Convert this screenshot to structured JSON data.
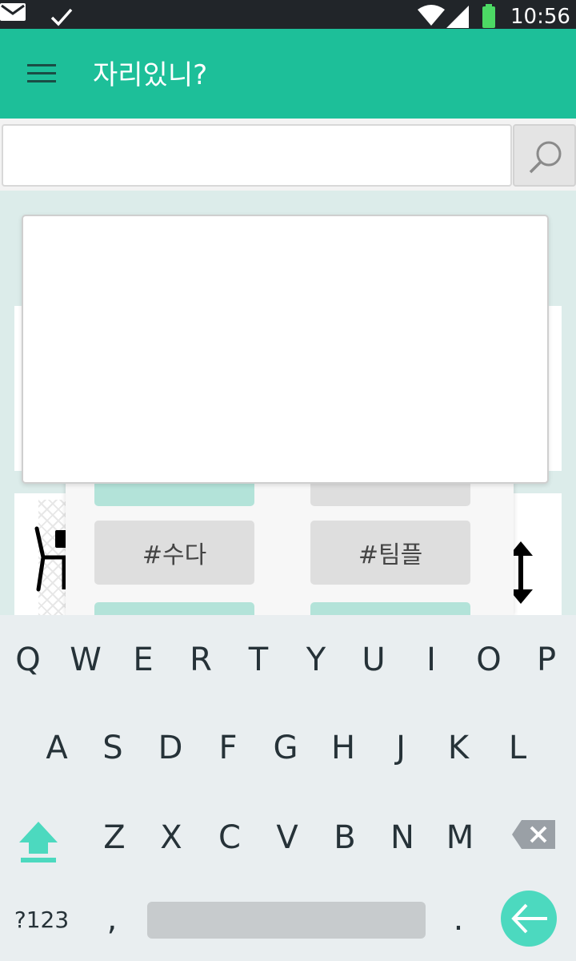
{
  "status_bar": {
    "time": "10:56",
    "icons": [
      "mail-icon",
      "check-icon",
      "wifi-icon",
      "cell-signal-icon",
      "battery-icon"
    ]
  },
  "app_bar": {
    "title": "자리있니?",
    "menu_icon": "hamburger-menu-icon"
  },
  "search": {
    "value": "",
    "button_icon": "search-icon"
  },
  "tags": {
    "row2_left": "#수다",
    "row2_right": "#팀플"
  },
  "keyboard": {
    "row1": [
      "Q",
      "W",
      "E",
      "R",
      "T",
      "Y",
      "U",
      "I",
      "O",
      "P"
    ],
    "row2": [
      "A",
      "S",
      "D",
      "F",
      "G",
      "H",
      "J",
      "K",
      "L"
    ],
    "row3": [
      "Z",
      "X",
      "C",
      "V",
      "B",
      "N",
      "M"
    ],
    "symbols": "?123",
    "comma": ",",
    "period": "."
  },
  "colors": {
    "accent": "#1dbf99",
    "enter": "#4cd9bf",
    "tag_teal": "#b3e3d9",
    "tag_gray": "#dedede"
  }
}
